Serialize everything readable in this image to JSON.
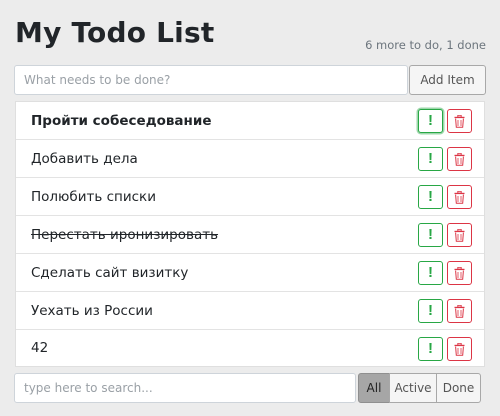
{
  "header": {
    "title": "My Todo List",
    "counter": "6 more to do, 1 done"
  },
  "add_form": {
    "placeholder": "What needs to be done?",
    "button_label": "Add Item"
  },
  "todo_items": [
    {
      "label": "Пройти собеседование",
      "important": true,
      "done": false
    },
    {
      "label": "Добавить дела",
      "important": false,
      "done": false
    },
    {
      "label": "Полюбить списки",
      "important": false,
      "done": false
    },
    {
      "label": "Перестать иронизировать",
      "important": false,
      "done": true
    },
    {
      "label": "Сделать сайт визитку",
      "important": false,
      "done": false
    },
    {
      "label": "Уехать из России",
      "important": false,
      "done": false
    },
    {
      "label": "42",
      "important": false,
      "done": false
    }
  ],
  "item_buttons": {
    "important_icon": "exclamation-icon",
    "important_glyph": "!",
    "delete_icon": "trash-icon"
  },
  "search": {
    "placeholder": "type here to search..."
  },
  "filters": {
    "all": "All",
    "active": "Active",
    "done": "Done",
    "selected": "All"
  },
  "colors": {
    "important_accent": "#28a745",
    "delete_accent": "#dc3545",
    "selected_filter_bg": "#a6a6a6"
  }
}
